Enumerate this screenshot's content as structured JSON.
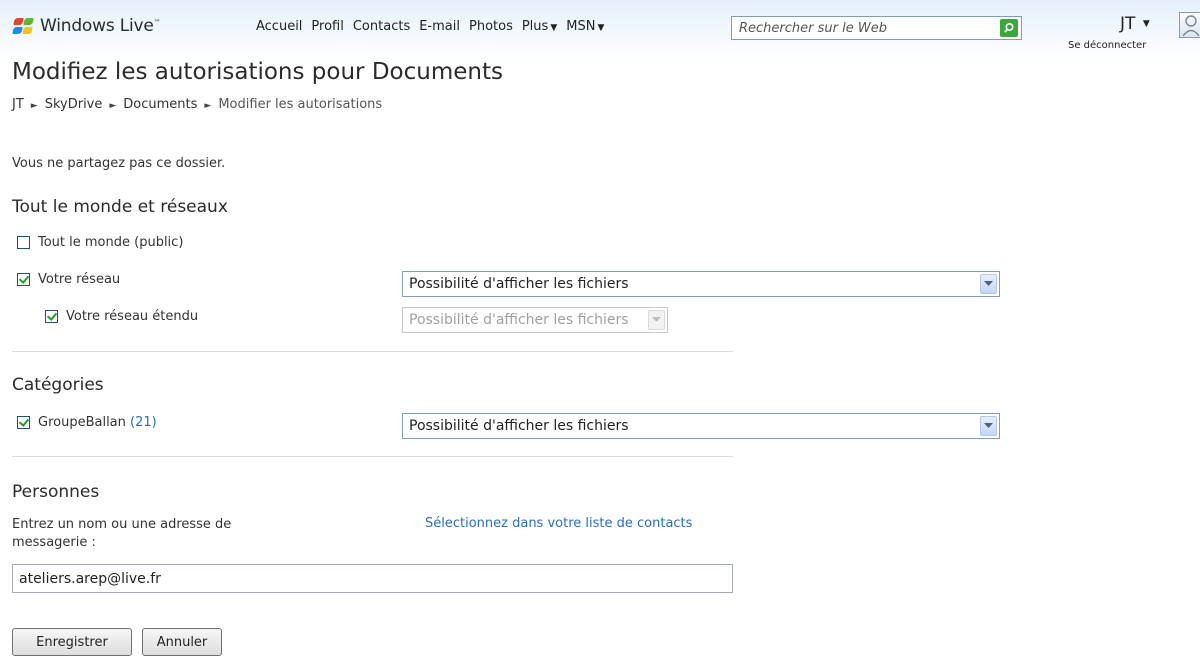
{
  "header": {
    "brand": "Windows Live",
    "brand_tm": "™",
    "nav": [
      {
        "label": "Accueil"
      },
      {
        "label": "Profil"
      },
      {
        "label": "Contacts"
      },
      {
        "label": "E-mail"
      },
      {
        "label": "Photos"
      },
      {
        "label": "Plus",
        "dropdown": true
      },
      {
        "label": "MSN",
        "dropdown": true
      }
    ],
    "search_placeholder": "Rechercher sur le Web",
    "user_initials": "JT",
    "signout": "Se déconnecter"
  },
  "page": {
    "title": "Modifiez les autorisations pour Documents",
    "breadcrumb": [
      "JT",
      "SkyDrive",
      "Documents",
      "Modifier les autorisations"
    ],
    "status": "Vous ne partagez pas ce dossier."
  },
  "everyone": {
    "title": "Tout le monde et réseaux",
    "public_label": "Tout le monde (public)",
    "public_checked": false,
    "network_label": "Votre réseau",
    "network_checked": true,
    "network_select": "Possibilité d'afficher les fichiers",
    "extended_label": "Votre réseau étendu",
    "extended_checked": true,
    "extended_select": "Possibilité d'afficher les fichiers"
  },
  "categories": {
    "title": "Catégories",
    "group_name": "GroupeBallan",
    "group_count": "(21)",
    "group_checked": true,
    "group_select": "Possibilité d'afficher les fichiers"
  },
  "people": {
    "title": "Personnes",
    "prompt": "Entrez un nom ou une adresse de messagerie :",
    "contacts_link": "Sélectionnez dans votre liste de contacts",
    "input_value": "ateliers.arep@live.fr"
  },
  "actions": {
    "save": "Enregistrer",
    "cancel": "Annuler"
  },
  "colors": {
    "link": "#2a6ebb",
    "check": "#21a121",
    "search_button": "#3ca73c"
  }
}
